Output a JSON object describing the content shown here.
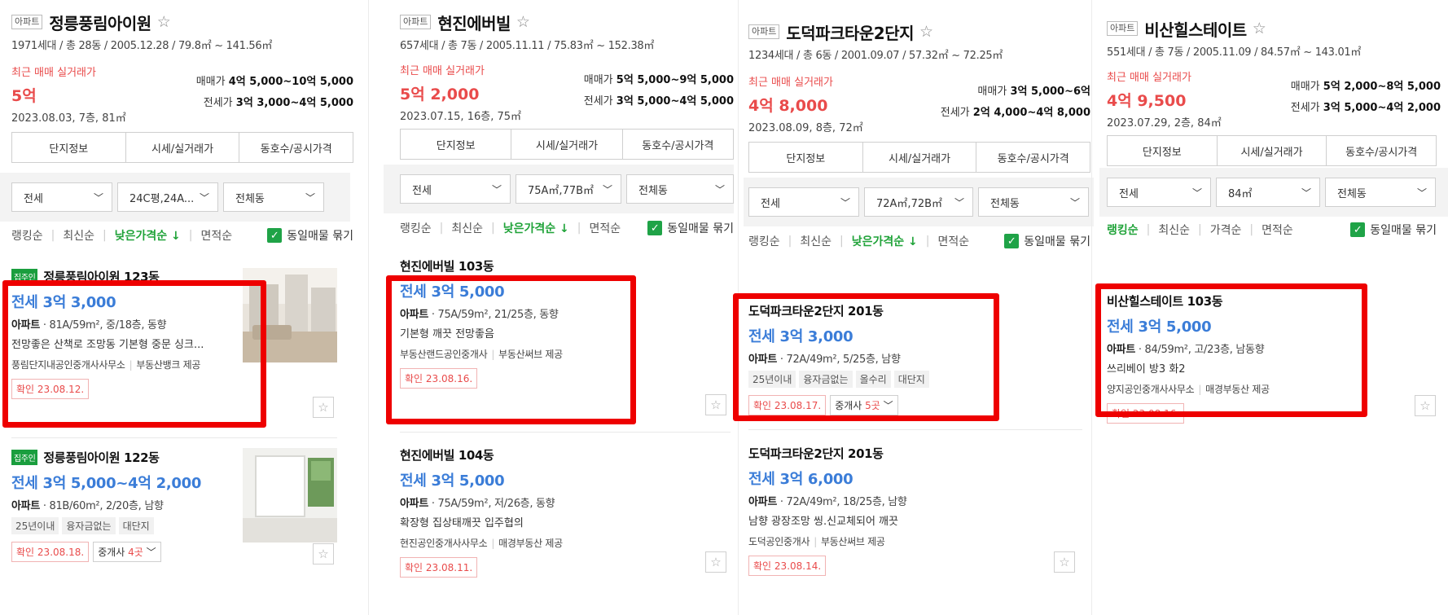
{
  "colors": {
    "accent_green": "#20a339",
    "price_blue": "#3b7dd8",
    "recent_red": "#e94b4b",
    "highlight_red": "#ee0000"
  },
  "apt_badge": "아파트",
  "recent_label": "최근 매매 실거래가",
  "sale_label": "매매가",
  "jeonse_label": "전세가",
  "tabs": [
    "단지정보",
    "시세/실거래가",
    "동호수/공시가격"
  ],
  "sorts": [
    "랭킹순",
    "최신순",
    "낮은가격순 ↓",
    "가격순",
    "면적순"
  ],
  "same_listing": "동일매물 묶기",
  "confirm_prefix": "확인",
  "owner_badge": "집주인",
  "broker_label": "중개사",
  "panels": [
    {
      "name": "정릉풍림아이원",
      "meta": "1971세대 / 총 28동 / 2005.12.28 / 79.8㎡ ~ 141.56㎡",
      "recent_price": "5억",
      "recent_date": "2023.08.03, 7층, 81㎡",
      "sale_range": "4억 5,000~10억 5,000",
      "jeonse_range": "3억 3,000~4억 5,000",
      "filters": [
        "전세",
        "24C평,24A...",
        "전체동"
      ],
      "sort_items": [
        "랭킹순",
        "최신순",
        "낮은가격순 ↓",
        "면적순"
      ],
      "listings": [
        {
          "title": "정릉풍림아이원 123동",
          "price": "전세 3억 3,000",
          "spec_type": "아파트",
          "spec": " · 81A/59m², 중/18층, 동향",
          "desc": "전망좋은 산책로 조망동 기본형 중문 싱크...",
          "agents": [
            "풍림단지내공인중개사사무소",
            "부동산뱅크 제공"
          ],
          "confirm": "23.08.12."
        },
        {
          "title": "정릉풍림아이원 122동",
          "price": "전세 3억 5,000~4억 2,000",
          "spec_type": "아파트",
          "spec": " · 81B/60m², 2/20층, 남향",
          "tags": [
            "25년이내",
            "융자금없는",
            "대단지"
          ],
          "confirm": "23.08.18.",
          "broker_count": "4곳"
        }
      ]
    },
    {
      "name": "현진에버빌",
      "meta": "657세대 / 총 7동 / 2005.11.11 / 75.83㎡ ~ 152.38㎡",
      "recent_price": "5억 2,000",
      "recent_date": "2023.07.15, 16층, 75㎡",
      "sale_range": "5억 5,000~9억 5,000",
      "jeonse_range": "3억 5,000~4억 5,000",
      "filters": [
        "전세",
        "75A㎡,77B㎡",
        "전체동"
      ],
      "sort_items": [
        "랭킹순",
        "최신순",
        "낮은가격순 ↓",
        "면적순"
      ],
      "listings": [
        {
          "title": "현진에버빌 103동",
          "price": "전세 3억 5,000",
          "spec_type": "아파트",
          "spec": " · 75A/59m², 21/25층, 동향",
          "desc": "기본형 깨끗 전망좋음",
          "agents": [
            "부동산랜드공인중개사",
            "부동산써브 제공"
          ],
          "confirm": "23.08.16."
        },
        {
          "title": "현진에버빌 104동",
          "price": "전세 3억 5,000",
          "spec_type": "아파트",
          "spec": " · 75A/59m², 저/26층, 동향",
          "desc": "확장형 집상태깨끗 입주협의",
          "agents": [
            "현진공인중개사사무소",
            "매경부동산 제공"
          ],
          "confirm": "23.08.11."
        }
      ]
    },
    {
      "name": "도덕파크타운2단지",
      "meta": "1234세대 / 총 6동 / 2001.09.07 / 57.32㎡ ~ 72.25㎡",
      "recent_price": "4억 8,000",
      "recent_date": "2023.08.09, 8층, 72㎡",
      "sale_range": "3억 5,000~6억",
      "jeonse_range": "2억 4,000~4억 8,000",
      "filters": [
        "전세",
        "72A㎡,72B㎡",
        "전체동"
      ],
      "sort_items": [
        "랭킹순",
        "최신순",
        "낮은가격순 ↓",
        "면적순"
      ],
      "listings": [
        {
          "title": "도덕파크타운2단지 201동",
          "price": "전세 3억 3,000",
          "spec_type": "아파트",
          "spec": " · 72A/49m², 5/25층, 남향",
          "tags": [
            "25년이내",
            "융자금없는",
            "올수리",
            "대단지"
          ],
          "confirm": "23.08.17.",
          "broker_count": "5곳"
        },
        {
          "title": "도덕파크타운2단지 201동",
          "price": "전세 3억 6,000",
          "spec_type": "아파트",
          "spec": " · 72A/49m², 18/25층, 남향",
          "desc": "남향 광장조망 씽.신교체되어 깨끗",
          "agents": [
            "도덕공인중개사",
            "부동산써브 제공"
          ],
          "confirm": "23.08.14."
        }
      ]
    },
    {
      "name": "비산힐스테이트",
      "meta": "551세대 / 총 7동 / 2005.11.09 / 84.57㎡ ~ 143.01㎡",
      "recent_price": "4억 9,500",
      "recent_date": "2023.07.29, 2층, 84㎡",
      "sale_range": "5억 2,000~8억 5,000",
      "jeonse_range": "3억 5,000~4억 2,000",
      "filters": [
        "전세",
        "84㎡",
        "전체동"
      ],
      "sort_items": [
        "랭킹순",
        "최신순",
        "가격순",
        "면적순"
      ],
      "listings": [
        {
          "title": "비산힐스테이트 103동",
          "price": "전세 3억 5,000",
          "spec_type": "아파트",
          "spec": " · 84/59m², 고/23층, 남동향",
          "desc": "쓰리베이 방3 화2",
          "agents": [
            "양지공인중개사사무소",
            "매경부동산 제공"
          ],
          "confirm": "23.08.16."
        }
      ]
    }
  ]
}
